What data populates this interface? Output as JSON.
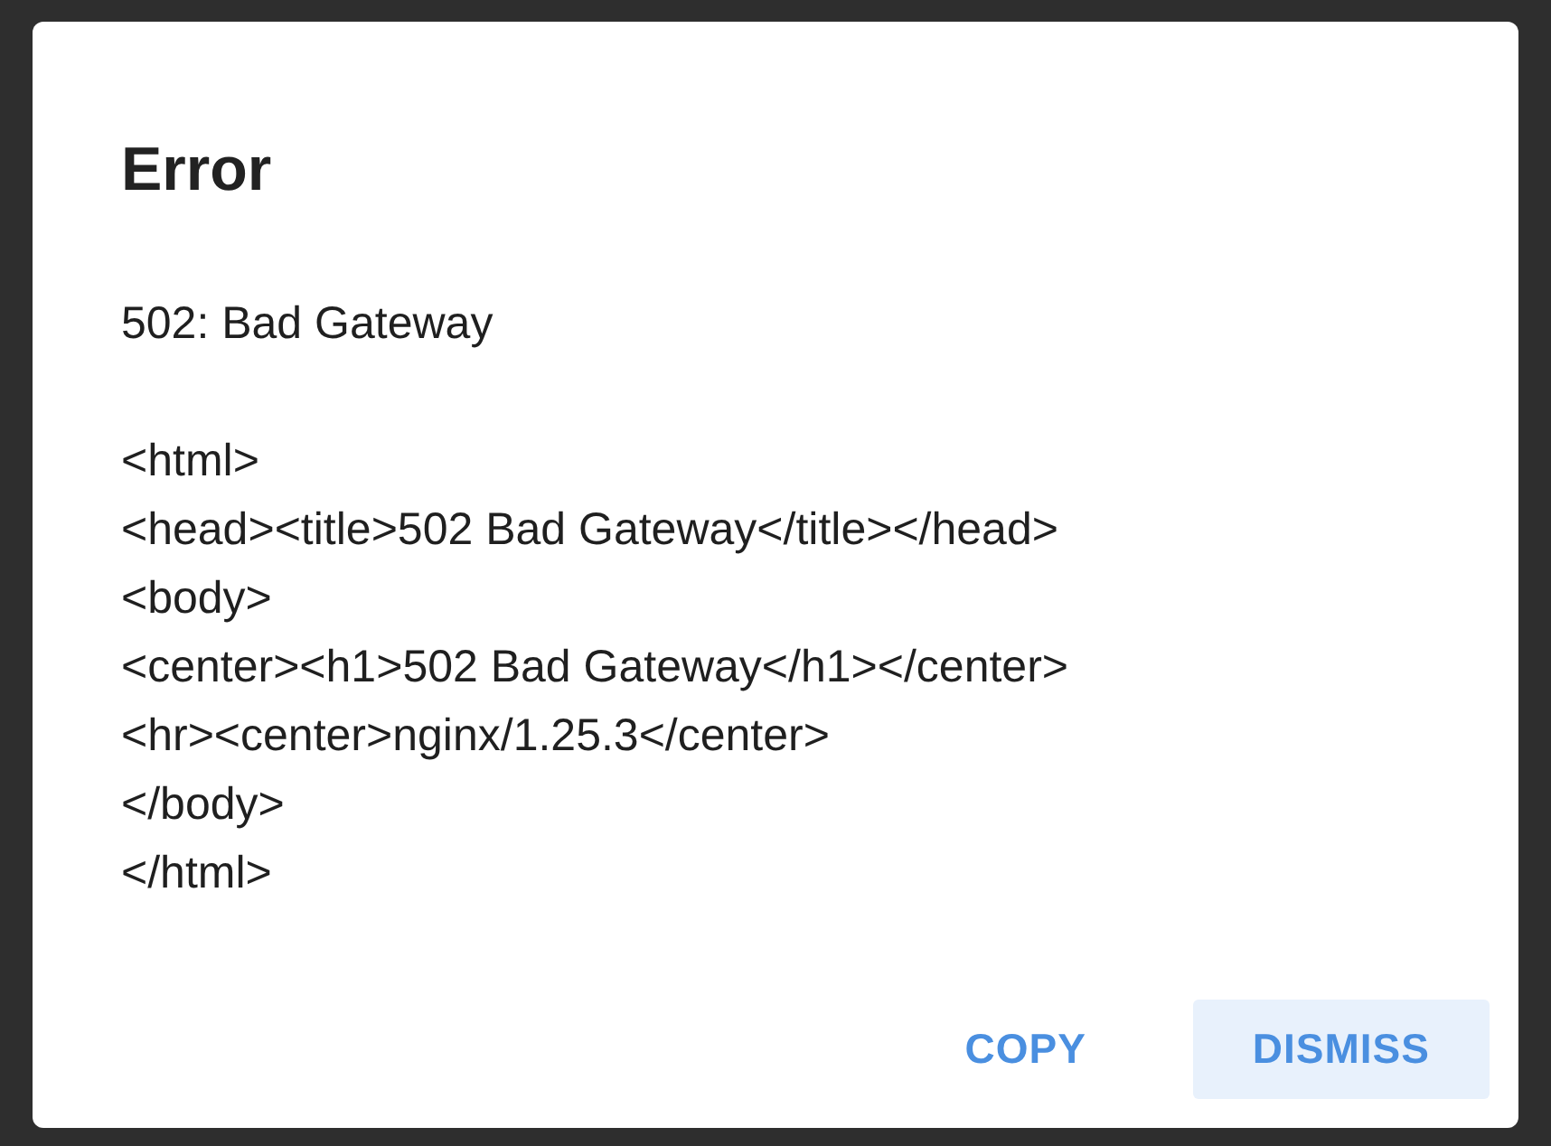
{
  "dialog": {
    "title": "Error",
    "message": "502: Bad Gateway\n\n<html>\n<head><title>502 Bad Gateway</title></head>\n<body>\n<center><h1>502 Bad Gateway</h1></center>\n<hr><center>nginx/1.25.3</center>\n</body>\n</html>",
    "buttons": [
      {
        "label": "COPY",
        "focused": false
      },
      {
        "label": "DISMISS",
        "focused": true
      }
    ]
  }
}
